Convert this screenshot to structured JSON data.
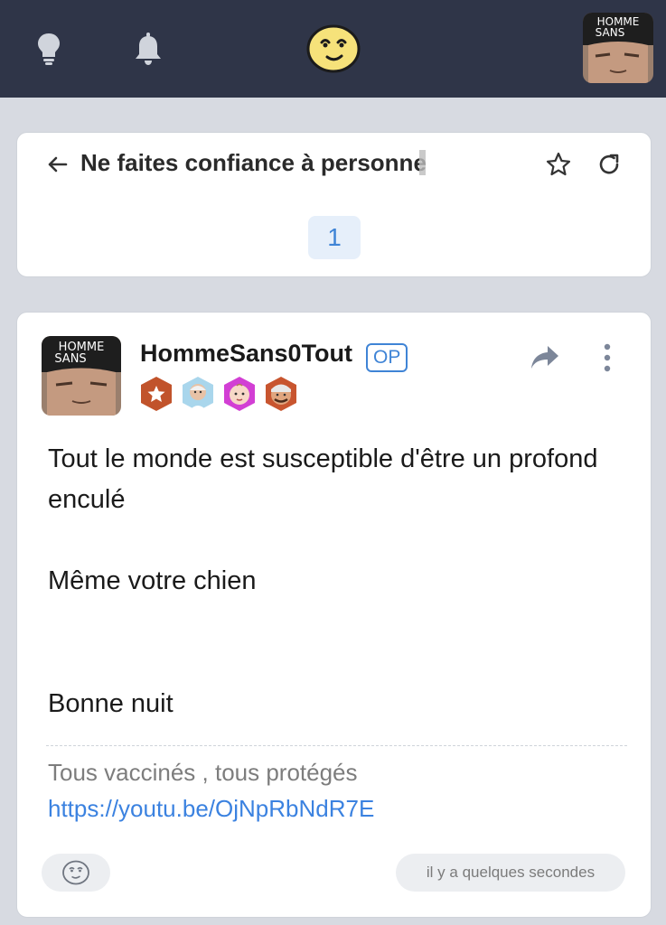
{
  "topbar": {
    "icons": [
      "lightbulb-icon",
      "bell-icon",
      "smiley-logo",
      "user-avatar"
    ],
    "avatar_text": [
      "HOMME",
      "SANS"
    ]
  },
  "topic": {
    "title": "Ne faites confiance à personne",
    "page": "1"
  },
  "post": {
    "author": "HommeSans0Tout",
    "op_label": "OP",
    "avatar_text": [
      "HOMME",
      "SANS"
    ],
    "badges": [
      "star-badge",
      "old-man-badge",
      "baby-badge",
      "face-badge"
    ],
    "body": [
      "Tout le monde est susceptible d'être un profond enculé",
      "Même votre chien",
      "Bonne nuit"
    ],
    "signature": {
      "text": "Tous vaccinés , tous protégés",
      "link": "https://youtu.be/OjNpRbNdR7E"
    },
    "timestamp": "il y a quelques secondes"
  },
  "colors": {
    "topbar": "#2f3548",
    "background": "#d7dae1",
    "accent": "#3f84d6",
    "link": "#3b82e0"
  }
}
